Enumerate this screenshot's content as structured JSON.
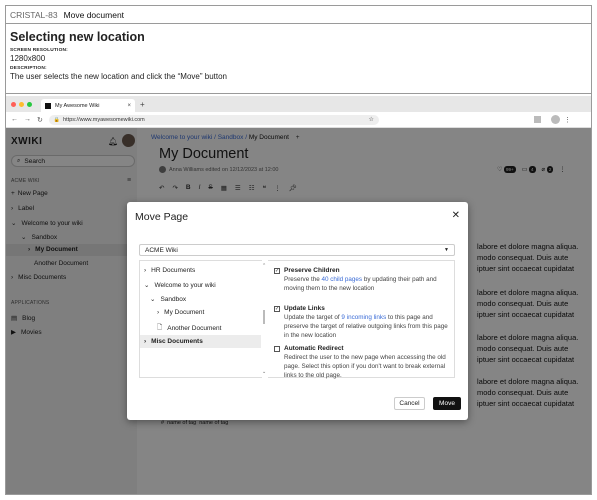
{
  "header": {
    "code": "CRISTAL-83",
    "name": "Move document"
  },
  "spec": {
    "title": "Selecting new location",
    "res_label": "SCREEN RESOLUTION:",
    "res_value": "1280x800",
    "desc_label": "DESCRIPTION:",
    "desc_value": "The user selects the new location and click the “Move” button"
  },
  "browser": {
    "tab_title": "My Awesome Wiki",
    "url": "https://www.myawesomewiki.com"
  },
  "sidebar": {
    "logo": "XWIKI",
    "search": "Search",
    "wiki_label": "ACME WIKI",
    "new_page": "New Page",
    "items": [
      "Label",
      "Welcome to your wiki",
      "Sandbox",
      "My Document",
      "Another Document",
      "Misc Documents"
    ],
    "apps_label": "APPLICATIONS",
    "apps": [
      "Blog",
      "Movies"
    ]
  },
  "main": {
    "crumb_1": "Welcome to your wiki",
    "crumb_2": "Sandbox",
    "crumb_3": "My Document",
    "title": "My Document",
    "meta": "Anna Williams edited on 12/12/2023 at 12:00",
    "badge_1": "99+",
    "badge_2": "4",
    "badge_3": "2",
    "para_line_1": "labore et dolore magna aliqua.",
    "para_line_2": "modo consequat. Duis aute",
    "para_line_3": "iptuer sint occaecat cupidatat",
    "tag_1": "name of tag",
    "tag_2": "name of tag"
  },
  "modal": {
    "title": "Move Page",
    "select": "ACME Wiki",
    "tree": [
      "HR Documents",
      "Welcome to your wiki",
      "Sandbox",
      "My Document",
      "Another Document",
      "Misc Documents"
    ],
    "opt1_title": "Preserve Children",
    "opt1_pre": "Preserve the ",
    "opt1_link": "40 child pages",
    "opt1_post": " by updating their path and moving them to the new location",
    "opt2_title": "Update Links",
    "opt2_pre": "Update the target of ",
    "opt2_link": "9 incoming links",
    "opt2_post": " to this page and preserve the target of relative outgoing links from this page in the new location",
    "opt3_title": "Automatic Redirect",
    "opt3_desc": "Redirect the user to the new page when accessing the old page. Select this option if you don't want to break external links to the old page.",
    "cancel": "Cancel",
    "move": "Move"
  }
}
